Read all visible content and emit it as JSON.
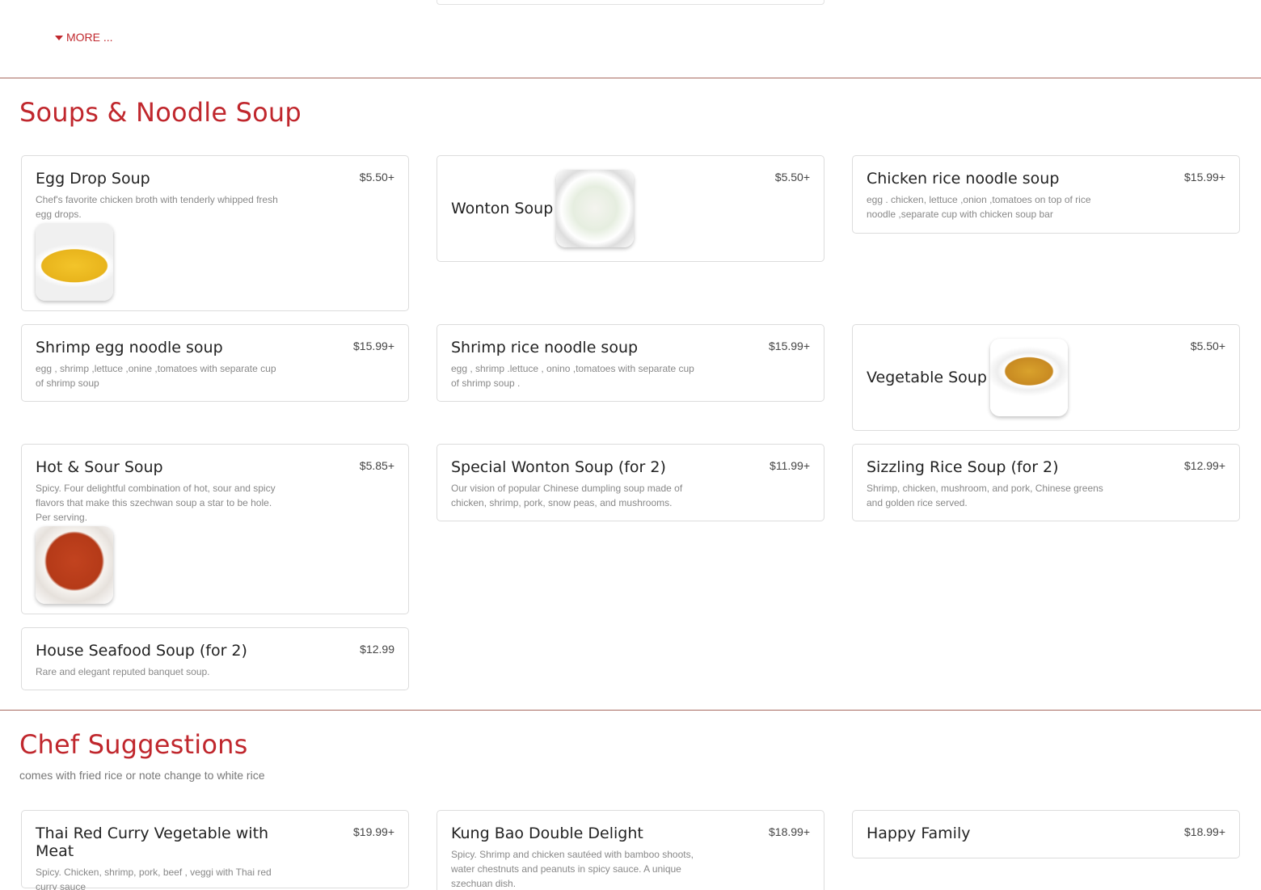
{
  "more_link": "MORE ...",
  "sections": {
    "soups": {
      "title": "Soups & Noodle Soup",
      "items": [
        {
          "name": "Egg Drop Soup",
          "price": "$5.50+",
          "desc": "Chef's favorite chicken broth with tenderly whipped fresh egg drops.",
          "image": "egg-drop-soup-photo"
        },
        {
          "name": "Wonton Soup",
          "price": "$5.50+",
          "desc": "",
          "image": "wonton-soup-photo"
        },
        {
          "name": "Chicken rice noodle soup",
          "price": "$15.99+",
          "desc": "egg . chicken, lettuce ,onion ,tomatoes on top of rice noodle ,separate cup with chicken soup bar",
          "image": ""
        },
        {
          "name": "Shrimp egg noodle soup",
          "price": "$15.99+",
          "desc": "egg , shrimp ,lettuce ,onine ,tomatoes with separate cup of shrimp soup",
          "image": ""
        },
        {
          "name": "Shrimp rice noodle soup",
          "price": "$15.99+",
          "desc": "egg , shrimp .lettuce , onino ,tomatoes with separate cup of shrimp soup .",
          "image": ""
        },
        {
          "name": "Vegetable Soup",
          "price": "$5.50+",
          "desc": "",
          "image": "vegetable-soup-photo"
        },
        {
          "name": "Hot & Sour Soup",
          "price": "$5.85+",
          "desc": "Spicy. Four delightful combination of hot, sour and spicy flavors that make this szechwan soup a star to be hole. Per serving.",
          "image": "hot-sour-soup-photo"
        },
        {
          "name": "Special Wonton Soup (for 2)",
          "price": "$11.99+",
          "desc": "Our vision of popular Chinese dumpling soup made of chicken, shrimp, pork, snow peas, and mushrooms.",
          "image": ""
        },
        {
          "name": "Sizzling Rice Soup (for 2)",
          "price": "$12.99+",
          "desc": "Shrimp, chicken, mushroom, and pork, Chinese greens and golden rice served.",
          "image": ""
        },
        {
          "name": "House Seafood Soup (for 2)",
          "price": "$12.99",
          "desc": "Rare and elegant reputed banquet soup.",
          "image": ""
        }
      ]
    },
    "chef": {
      "title": "Chef Suggestions",
      "subtitle": "comes with fried rice or note change to white rice",
      "items": [
        {
          "name": "Thai Red Curry Vegetable with Meat",
          "price": "$19.99+",
          "desc": "Spicy. Chicken, shrimp, pork, beef , veggi with Thai red curry sauce"
        },
        {
          "name": "Kung Bao Double Delight",
          "price": "$18.99+",
          "desc": "Spicy. Shrimp and chicken sautéed with bamboo shoots, water chestnuts and peanuts in spicy sauce. A unique szechuan dish."
        },
        {
          "name": "Happy Family",
          "price": "$18.99+",
          "desc": ""
        }
      ]
    }
  },
  "colors": {
    "accent": "#c0272d",
    "divider": "#a86a60",
    "card_border": "#dcdcdc",
    "desc_text": "#888888"
  }
}
